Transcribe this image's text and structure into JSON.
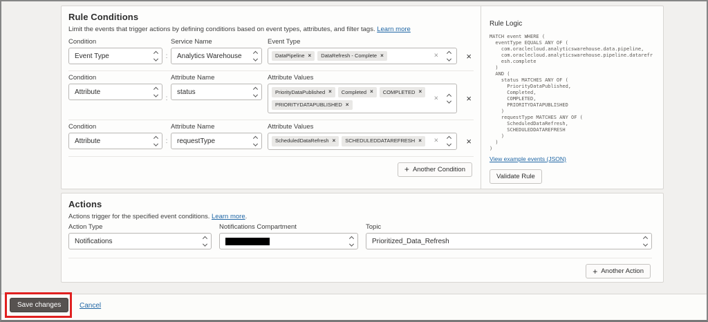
{
  "icons": {
    "plus": "+",
    "chip_close": "×",
    "clear": "×",
    "remove_row": "×",
    "colon": ":"
  },
  "colors": {
    "link_blue": "#1f66a5",
    "save_button_bg": "#575250",
    "annotation_red": "#e02020",
    "chip_bg": "#e9e8e6"
  },
  "rule_conditions": {
    "title": "Rule Conditions",
    "description": "Limit the events that trigger actions by defining conditions based on event types, attributes, and filter tags.",
    "learn_more": "Learn more",
    "another_condition_label": "Another Condition",
    "rows": [
      {
        "condition_label": "Condition",
        "condition_value": "Event Type",
        "name_label": "Service Name",
        "name_value": "Analytics Warehouse",
        "values_label": "Event Type",
        "tags": [
          "DataPipeline",
          "DataRefresh - Complete"
        ]
      },
      {
        "condition_label": "Condition",
        "condition_value": "Attribute",
        "name_label": "Attribute Name",
        "name_value": "status",
        "values_label": "Attribute Values",
        "tags": [
          "PriorityDataPublished",
          "Completed",
          "COMPLETED",
          "PRIORITYDATAPUBLISHED"
        ]
      },
      {
        "condition_label": "Condition",
        "condition_value": "Attribute",
        "name_label": "Attribute Name",
        "name_value": "requestType",
        "values_label": "Attribute Values",
        "tags": [
          "ScheduledDataRefresh",
          "SCHEDULEDDATAREFRESH"
        ]
      }
    ]
  },
  "rule_logic": {
    "title": "Rule Logic",
    "code": "MATCH event WHERE (\n  eventType EQUALS ANY OF (\n    com.oraclecloud.analyticswarehouse.data.pipeline,\n    com.oraclecloud.analyticswarehouse.pipeline.datarefr\n    esh.complete\n  )\n  AND (\n    status MATCHES ANY OF (\n      PriorityDataPublished,\n      Completed,\n      COMPLETED,\n      PRIORITYDATAPUBLISHED\n    )\n    requestType MATCHES ANY OF (\n      ScheduledDataRefresh,\n      SCHEDULEDDATAREFRESH\n    )\n  )\n)",
    "example_link": "View example events (JSON)",
    "validate_button": "Validate Rule"
  },
  "actions": {
    "title": "Actions",
    "description": "Actions trigger for the specified event conditions.",
    "learn_more": "Learn more",
    "learn_more_suffix": ".",
    "action_type_label": "Action Type",
    "action_type_value": "Notifications",
    "compartment_label": "Notifications Compartment",
    "topic_label": "Topic",
    "topic_value": "Prioritized_Data_Refresh",
    "another_action_label": "Another Action"
  },
  "footer": {
    "save_label": "Save changes",
    "cancel_label": "Cancel"
  }
}
